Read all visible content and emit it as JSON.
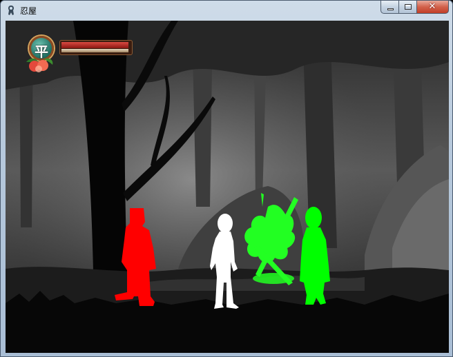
{
  "window": {
    "title": "忍屋",
    "controls": {
      "minimize": "",
      "maximize": "",
      "close": "✕"
    }
  },
  "hud": {
    "status_glyph": "平",
    "health_level": 0.97,
    "energy_level": 0.97,
    "colors": {
      "health": "#b0201a",
      "energy": "#d8c7a8",
      "badge": "#2a7d6e"
    }
  },
  "scene": {
    "characters": [
      {
        "name": "red-silhouette",
        "color": "#ff0000"
      },
      {
        "name": "white-silhouette",
        "color": "#ffffff"
      },
      {
        "name": "green-bush-silhouette",
        "color": "#22ff22"
      },
      {
        "name": "green-silhouette",
        "color": "#00ff00"
      }
    ]
  }
}
